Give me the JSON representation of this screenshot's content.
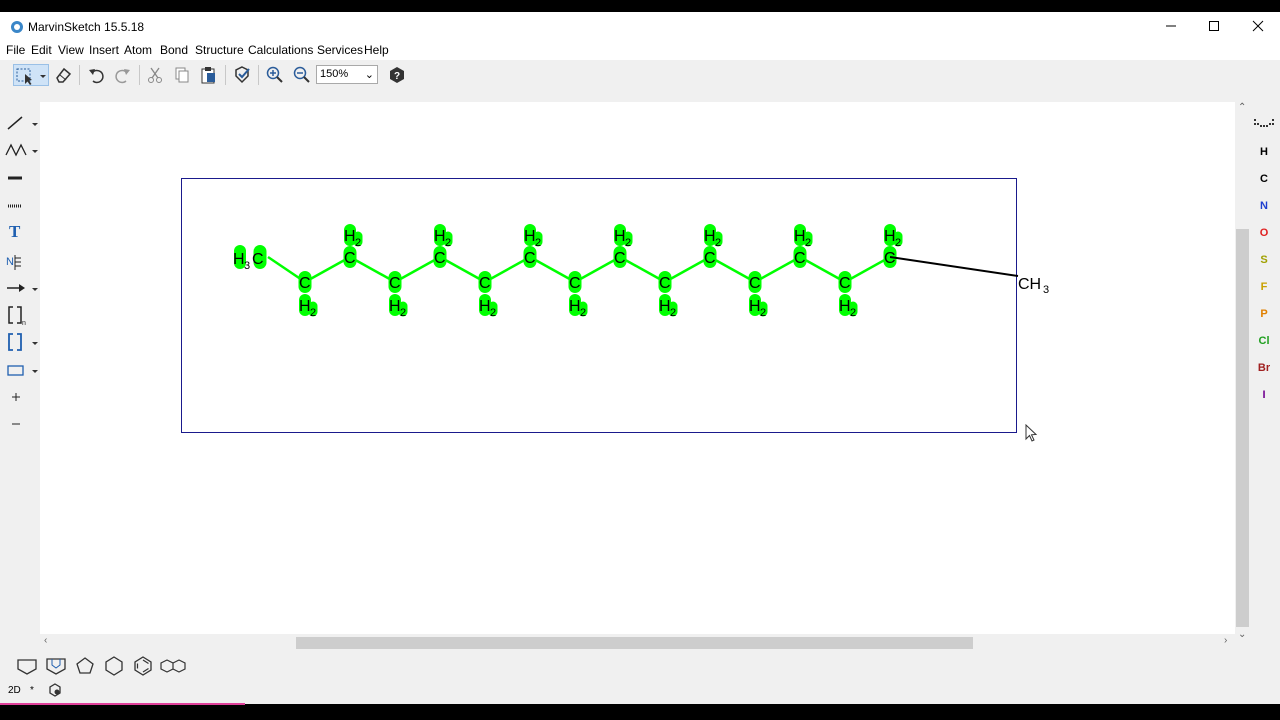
{
  "window": {
    "title": "MarvinSketch 15.5.18",
    "app_icon": "marvin-icon",
    "controls": [
      "minimize-icon",
      "maximize-icon",
      "close-icon"
    ]
  },
  "menu": [
    "File",
    "Edit",
    "View",
    "Insert",
    "Atom",
    "Bond",
    "Structure",
    "Calculations",
    "Services",
    "Help"
  ],
  "toolbar": {
    "zoom": "150%",
    "icons": [
      "select-icon",
      "eraser-icon",
      "undo-icon",
      "redo-icon",
      "cut-icon",
      "copy-icon",
      "paste-icon",
      "clean-icon",
      "zoom-in-icon",
      "zoom-out-icon",
      "help-icon"
    ]
  },
  "left_tools": {
    "text_tool": "T",
    "icons": [
      "single-bond-icon",
      "chain-icon",
      "bond-type-icon",
      "dashed-bond-icon",
      "text-icon",
      "atom-label-icon",
      "arrow-icon",
      "sgroup-bracket-icon",
      "bracket-icon",
      "rectangle-icon",
      "plus-icon",
      "minus-icon"
    ]
  },
  "periodic": [
    {
      "symbol": "H",
      "color": "#000000"
    },
    {
      "symbol": "C",
      "color": "#000000"
    },
    {
      "symbol": "N",
      "color": "#1f3fd0"
    },
    {
      "symbol": "O",
      "color": "#e02020"
    },
    {
      "symbol": "S",
      "color": "#a0a000"
    },
    {
      "symbol": "F",
      "color": "#c8a000"
    },
    {
      "symbol": "P",
      "color": "#e08000"
    },
    {
      "symbol": "Cl",
      "color": "#20a020"
    },
    {
      "symbol": "Br",
      "color": "#a02020"
    },
    {
      "symbol": "I",
      "color": "#700090"
    }
  ],
  "molecule": {
    "start_label": {
      "main": "H",
      "sub": "3",
      "tail": "C"
    },
    "end_label": {
      "main": "CH",
      "sub": "3"
    },
    "carbon": "C",
    "hydrogen": "H",
    "h_count": "2",
    "highlight_color": "#00ff00"
  },
  "templates": [
    "cyclopropane-icon",
    "cyclobutane-icon",
    "cyclopentane-icon",
    "cyclohexane-icon",
    "benzene-icon",
    "naphthalene-icon"
  ],
  "status": {
    "mode": "2D",
    "mark": "*",
    "icon": "status-icon"
  }
}
